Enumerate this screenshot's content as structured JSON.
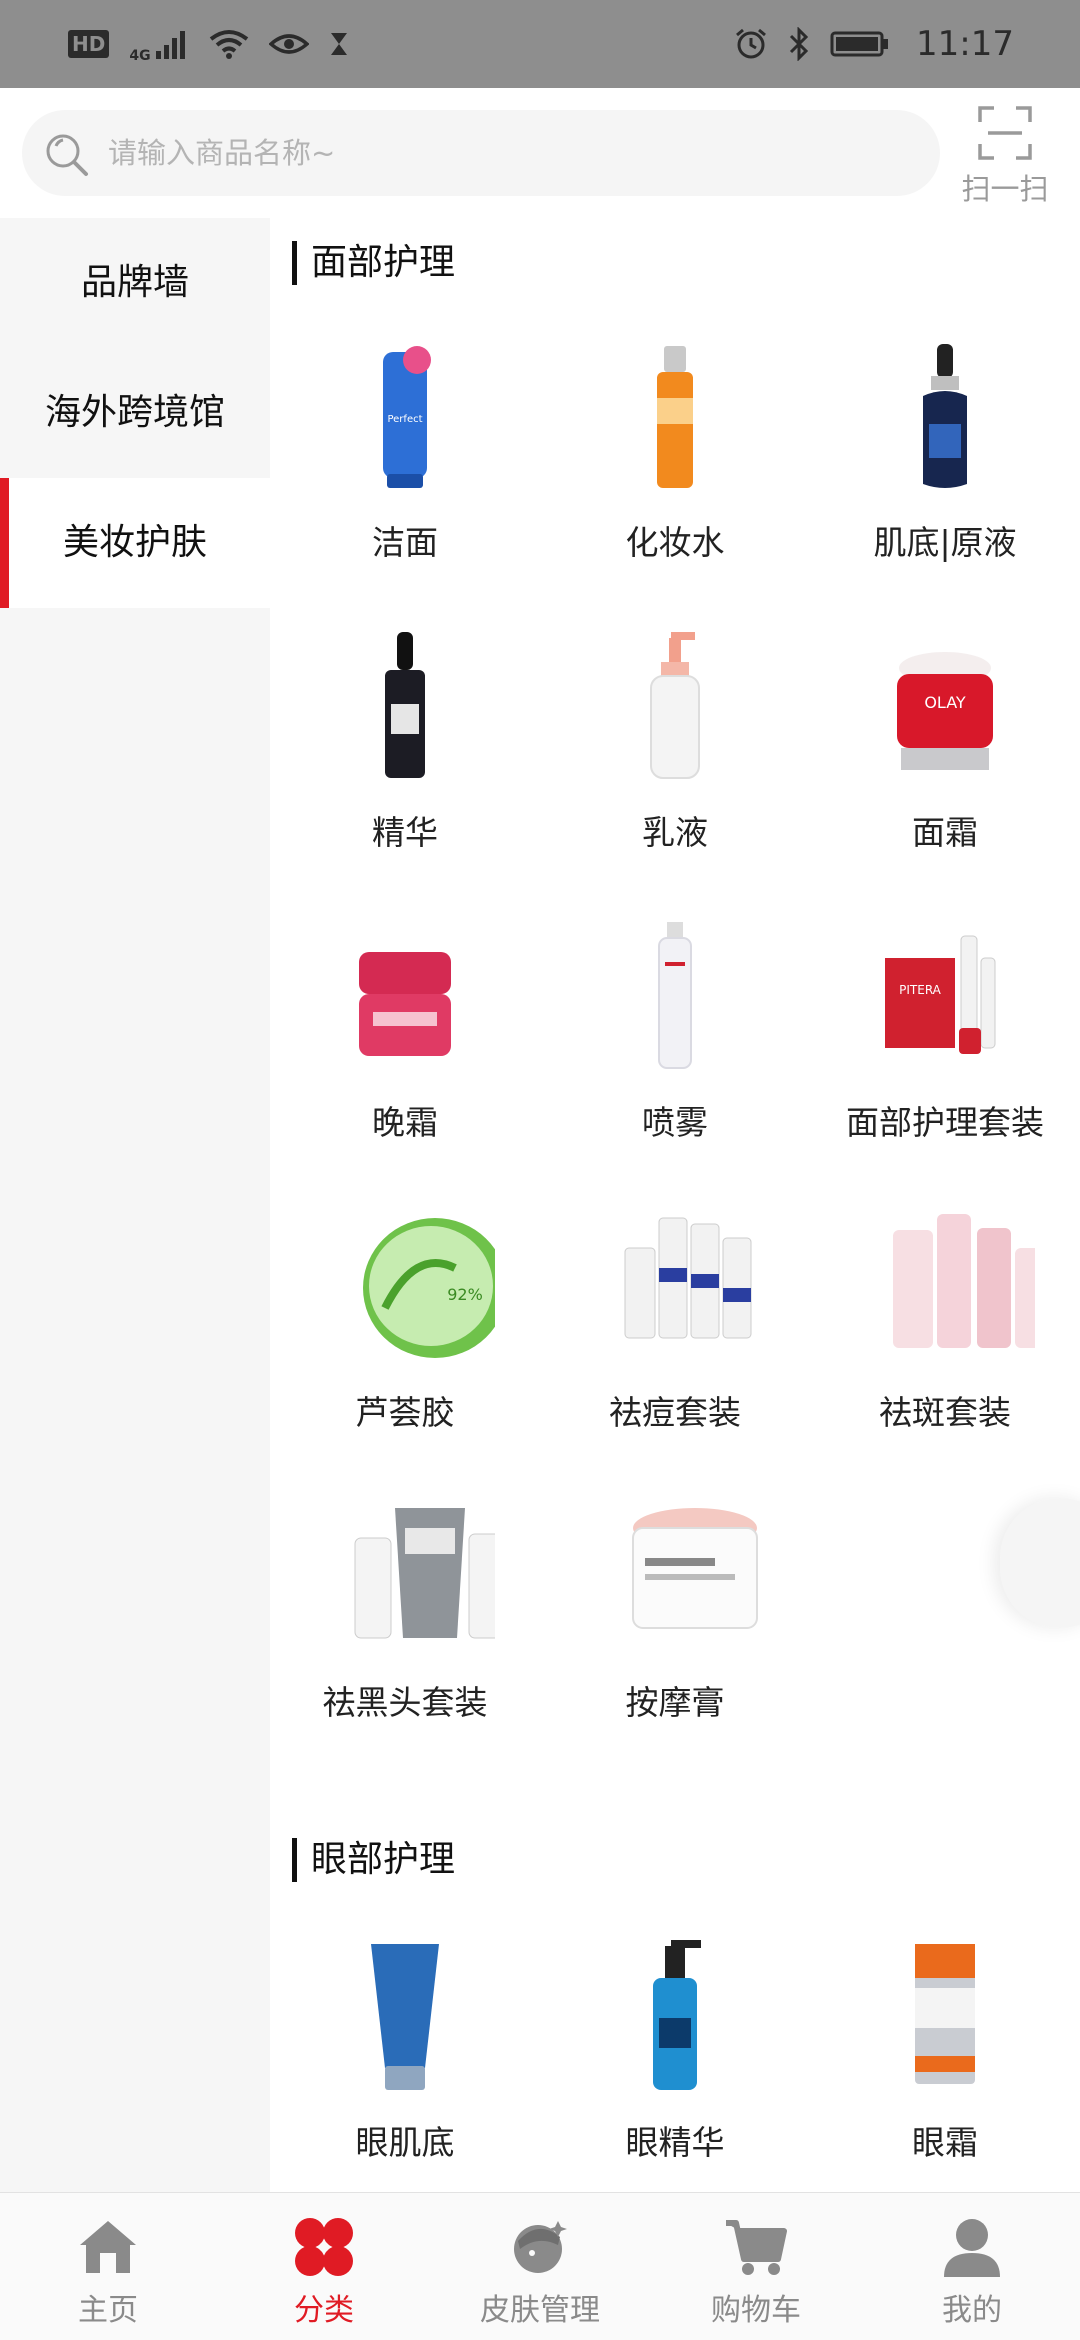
{
  "status_bar": {
    "hd": "HD",
    "signal_text": "4G",
    "time": "11:17",
    "icons": [
      "hd-icon",
      "signal-icon",
      "wifi-icon",
      "eye-icon",
      "hourglass-icon",
      "alarm-icon",
      "bluetooth-icon",
      "battery-icon"
    ]
  },
  "search": {
    "placeholder": "请输入商品名称~",
    "scan_label": "扫一扫"
  },
  "sidebar": {
    "items": [
      {
        "label": "品牌墙"
      },
      {
        "label": "海外跨境馆"
      },
      {
        "label": "美妆护肤",
        "active": true
      }
    ]
  },
  "sections": [
    {
      "title": "面部护理",
      "items": [
        {
          "label": "洁面",
          "icon": "cleanser-tube-image",
          "color": "#2d6fd6"
        },
        {
          "label": "化妆水",
          "icon": "toner-bottle-image",
          "color": "#f28a1e"
        },
        {
          "label": "肌底|原液",
          "icon": "serum-dropper-image",
          "color": "#17264f"
        },
        {
          "label": "精华",
          "icon": "essence-dropper-image",
          "color": "#1c1c24"
        },
        {
          "label": "乳液",
          "icon": "lotion-pump-image",
          "color": "#f2a08c"
        },
        {
          "label": "面霜",
          "icon": "face-cream-jar-image",
          "color": "#d8182a"
        },
        {
          "label": "晚霜",
          "icon": "night-cream-jar-image",
          "color": "#d42a52"
        },
        {
          "label": "喷雾",
          "icon": "spray-can-image",
          "color": "#e8e8ee"
        },
        {
          "label": "面部护理套装",
          "icon": "facial-set-image",
          "color": "#d0212f"
        },
        {
          "label": "芦荟胶",
          "icon": "aloe-gel-jar-image",
          "color": "#6fc24a"
        },
        {
          "label": "祛痘套装",
          "icon": "acne-set-image",
          "color": "#2a3ea0"
        },
        {
          "label": "祛斑套装",
          "icon": "spot-set-image",
          "color": "#f0c4cc"
        },
        {
          "label": "祛黑头套装",
          "icon": "blackhead-set-image",
          "color": "#8f9499"
        },
        {
          "label": "按摩膏",
          "icon": "massage-gel-jar-image",
          "color": "#f4c9c2"
        }
      ]
    },
    {
      "title": "眼部护理",
      "items": [
        {
          "label": "眼肌底",
          "icon": "eye-base-tube-image",
          "color": "#2a6cb8"
        },
        {
          "label": "眼精华",
          "icon": "eye-essence-bottle-image",
          "color": "#1f8fd0"
        },
        {
          "label": "眼霜",
          "icon": "eye-cream-box-image",
          "color": "#ea6a1c"
        }
      ]
    }
  ],
  "bottom_nav": {
    "accent": "#e01b24",
    "inactive": "#8a8a8a",
    "items": [
      {
        "label": "主页",
        "icon": "home-icon"
      },
      {
        "label": "分类",
        "icon": "category-icon",
        "active": true
      },
      {
        "label": "皮肤管理",
        "icon": "skin-care-icon"
      },
      {
        "label": "购物车",
        "icon": "cart-icon"
      },
      {
        "label": "我的",
        "icon": "profile-icon"
      }
    ]
  }
}
